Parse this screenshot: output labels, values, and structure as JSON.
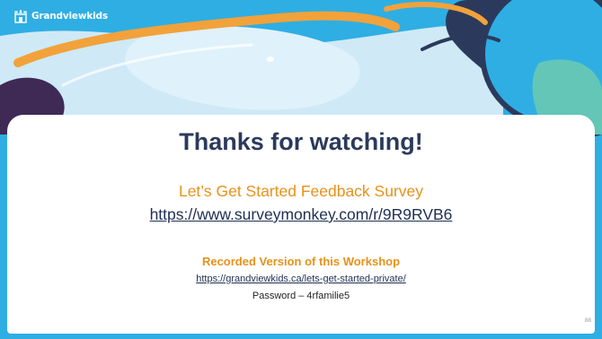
{
  "logo": {
    "text": "Grandviewkids",
    "icon": "castle-logo-icon"
  },
  "slide": {
    "heading": "Thanks for watching!",
    "survey_title": "Let’s Get Started Feedback Survey",
    "survey_url": "https://www.surveymonkey.com/r/9R9RVB6",
    "recorded_title": "Recorded Version of this Workshop",
    "recorded_url": "https://grandviewkids.ca/lets-get-started-private/",
    "password": "Password – 4rfamilie5",
    "number": "88"
  },
  "colors": {
    "sky_blue": "#2eaee3",
    "light_blue": "#cfe9f7",
    "navy": "#2b3a5c",
    "orange": "#f2a23a",
    "purple": "#3f2a56",
    "teal": "#63c6b7",
    "accent_text": "#e8911a"
  }
}
